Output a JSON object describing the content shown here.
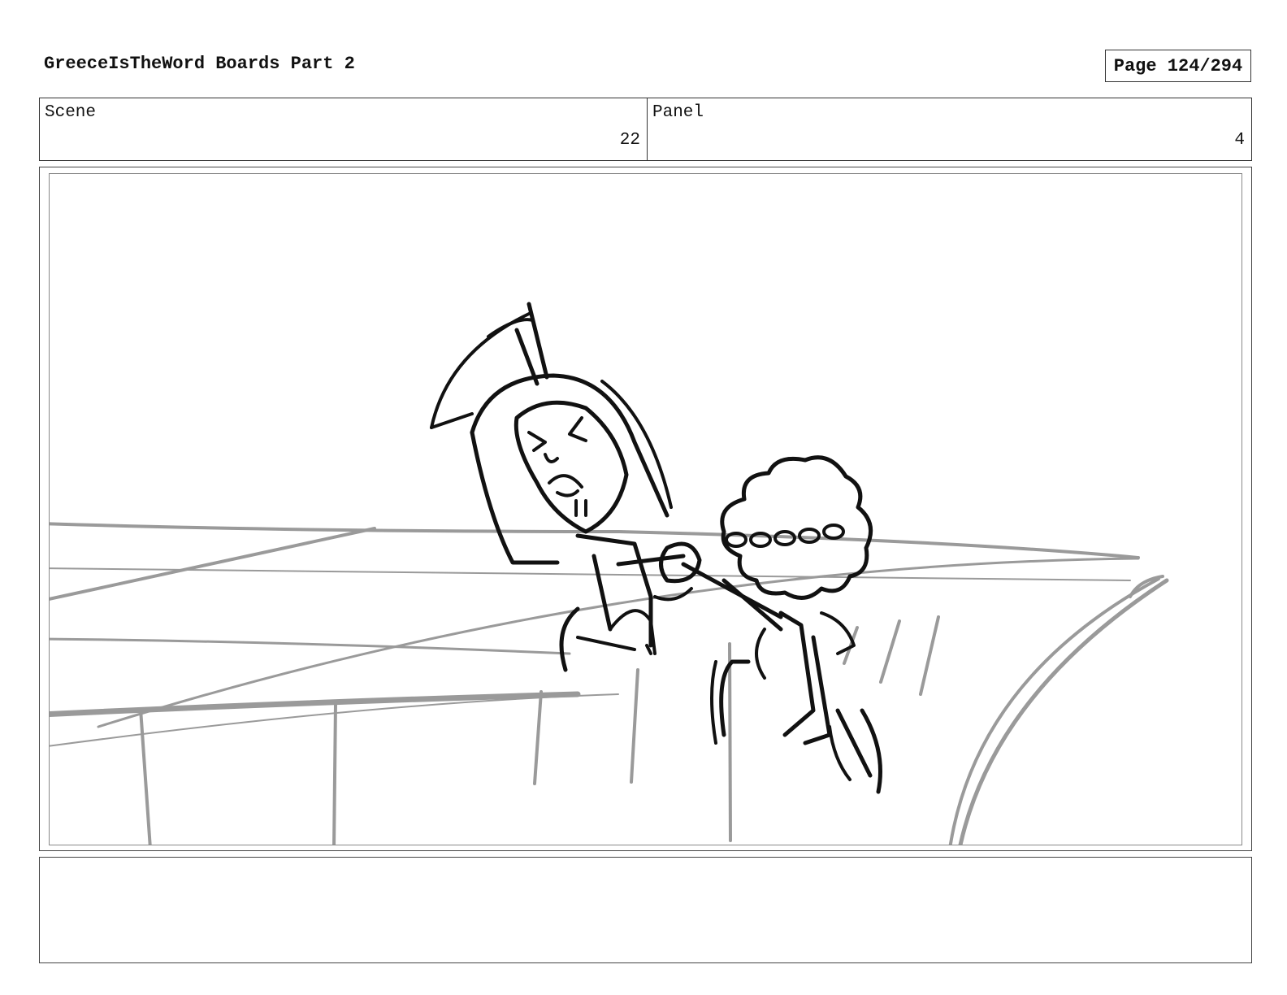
{
  "header": {
    "title": "GreeceIsTheWord Boards Part 2",
    "page_label": "Page 124/294"
  },
  "info": {
    "scene_label": "Scene",
    "scene_value": "22",
    "panel_label": "Panel",
    "panel_value": "4"
  },
  "frame": {
    "background_color": "#ffffff",
    "ink_color": "#111111",
    "guide_color": "#9a9a9a"
  },
  "notes": {
    "text": ""
  }
}
